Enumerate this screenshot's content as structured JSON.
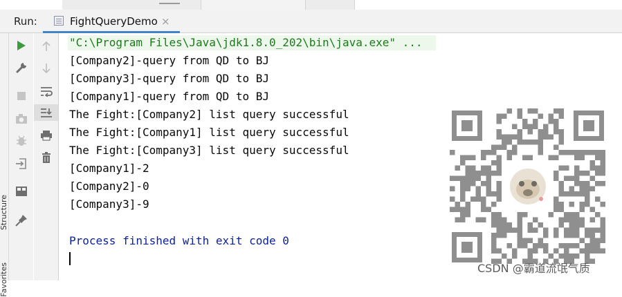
{
  "run_panel": {
    "label": "Run:",
    "tab_title": "FightQueryDemo",
    "tab_close": "×"
  },
  "side_labels": {
    "structure": "Structure",
    "favorites": "Favorites"
  },
  "toolbar_left": [
    "run-icon",
    "wrench-icon",
    "stop-icon",
    "camera-icon",
    "bug-icon",
    "exit-icon",
    "layout-icon",
    "pin-icon"
  ],
  "toolbar_right": [
    "arrow-up-icon",
    "arrow-down-icon",
    "soft-wrap-icon",
    "scroll-to-end-icon",
    "print-icon",
    "trash-icon"
  ],
  "console": {
    "command": "\"C:\\Program Files\\Java\\jdk1.8.0_202\\bin\\java.exe\" ...",
    "lines": [
      "[Company2]-query from QD to BJ",
      "[Company3]-query from QD to BJ",
      "[Company1]-query from QD to BJ",
      "The Fight:[Company2] list query successful",
      "The Fight:[Company1] list query successful",
      "The Fight:[Company3] list query successful",
      "[Company1]-2",
      "[Company2]-0",
      "[Company3]-9"
    ],
    "exit_message": "Process finished with exit code 0"
  },
  "watermark": "CSDN @霸道流氓气质",
  "colors": {
    "command_text": "#1d7a1d",
    "exit_text": "#0a1f9a",
    "tab_underline": "#4083c9",
    "run_green": "#3d9b3d"
  }
}
